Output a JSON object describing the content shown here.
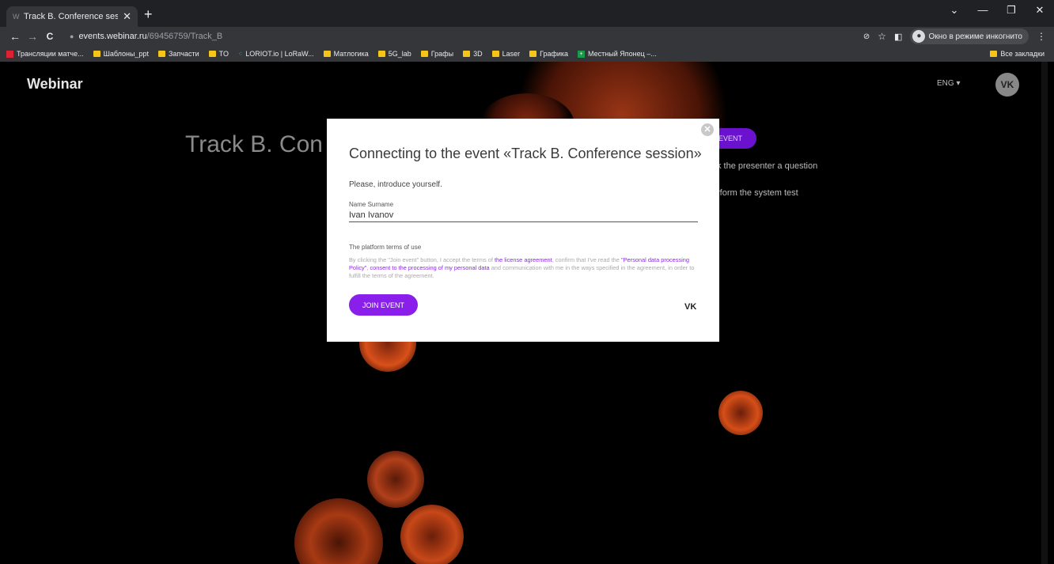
{
  "browser": {
    "tab_title": "Track B. Conference session - We",
    "tab_favicon": "W",
    "tab_close": "✕",
    "new_tab": "+",
    "window_controls": [
      "⌄",
      "—",
      "❐",
      "✕"
    ],
    "nav": {
      "back": "←",
      "forward": "→",
      "reload": "C"
    },
    "url_host": "events.webinar.ru",
    "url_path": "/69456759/Track_B",
    "incognito_label": "Окно в режиме инкогнито",
    "menu_icon": "⋮",
    "bookmarks": [
      {
        "label": "Трансляции матче...",
        "icon": "image"
      },
      {
        "label": "Шаблоны_ppt",
        "icon": "folder"
      },
      {
        "label": "Запчасти",
        "icon": "folder"
      },
      {
        "label": "TO",
        "icon": "folder"
      },
      {
        "label": "LORIOT.io | LoRaW...",
        "icon": "lora"
      },
      {
        "label": "Матлогика",
        "icon": "folder"
      },
      {
        "label": "5G_lab",
        "icon": "folder"
      },
      {
        "label": "Графы",
        "icon": "folder"
      },
      {
        "label": "3D",
        "icon": "folder"
      },
      {
        "label": "Laser",
        "icon": "folder"
      },
      {
        "label": "Графика",
        "icon": "folder"
      },
      {
        "label": "Местный Японец –...",
        "icon": "green"
      }
    ],
    "all_bookmarks": "Все закладки"
  },
  "page": {
    "logo": "Webinar",
    "lang": "ENG ▾",
    "vk_icon": "VK",
    "bg_title": "Track B. Con",
    "bg_event_button": "EVENT",
    "bg_line1": "k the presenter a question",
    "bg_line2": "rform the system test"
  },
  "modal": {
    "close": "✕",
    "title": "Connecting to the event «Track B. Conference session»",
    "intro": "Please, introduce yourself.",
    "field_label": "Name Surname",
    "field_value": "Ivan Ivanov",
    "terms_heading": "The platform terms of use",
    "terms_parts": [
      "By clicking the \"Join event\" button, I accept the terms of ",
      "the license agreement",
      ", confirm that I've read the ",
      "\"Personal data processing Policy\"",
      ", ",
      "consent to the processing of my personal data",
      " and communication with me in the ways specified in the agreement, in order to fulfill the terms of the agreement."
    ],
    "join_button": "JOIN EVENT",
    "vk_icon": "VK"
  },
  "colors": {
    "accent": "#8a1eea",
    "blob": "#ff5a1f"
  }
}
